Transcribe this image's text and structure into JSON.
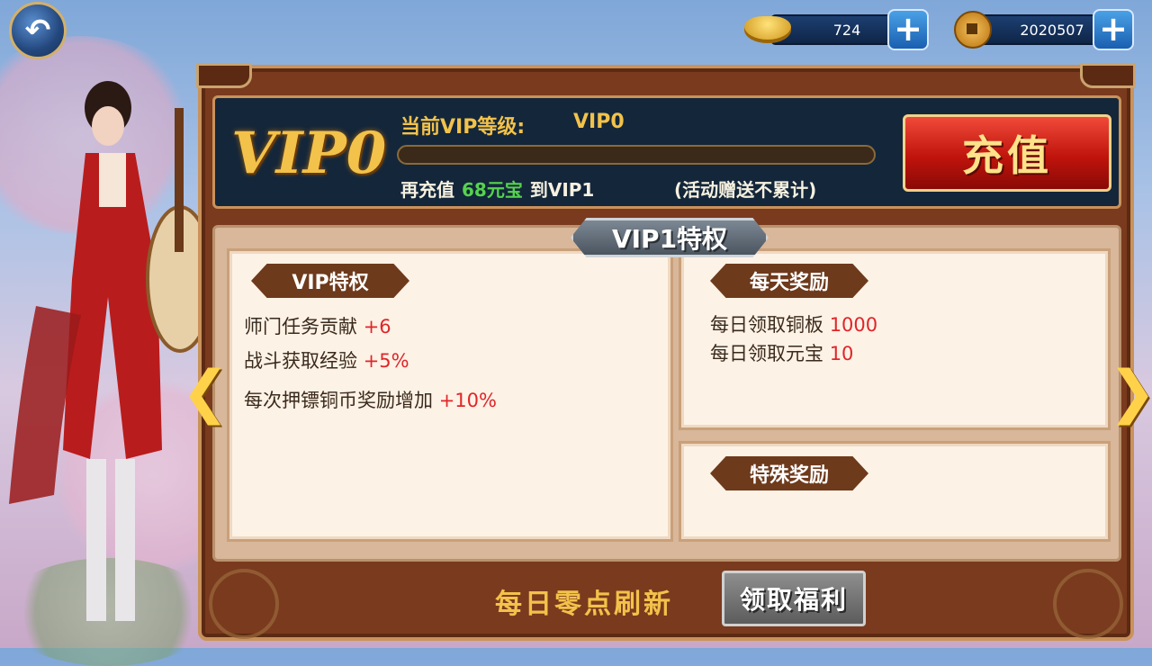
{
  "currency": {
    "gold": "724",
    "coins": "2020507"
  },
  "vip": {
    "badge": "VIP0",
    "current_label": "当前VIP等级:",
    "current_level": "VIP0",
    "progress": 0.0,
    "recharge_prefix": "再充值",
    "recharge_amount": "68元宝",
    "recharge_suffix": "到VIP1",
    "note": "(活动赠送不累计)",
    "recharge_button": "充值"
  },
  "privilege": {
    "title": "VIP1特权",
    "left": {
      "label": "VIP特权",
      "items": [
        {
          "text": "师门任务贡献",
          "value": "+6"
        },
        {
          "text": "战斗获取经验",
          "value": "+5%"
        },
        {
          "text": "每次押镖铜币奖励增加",
          "value": "+10%"
        }
      ]
    },
    "daily": {
      "label": "每天奖励",
      "items": [
        {
          "text": "每日领取铜板",
          "value": "1000"
        },
        {
          "text": "每日领取元宝",
          "value": "10"
        }
      ]
    },
    "special": {
      "label": "特殊奖励"
    }
  },
  "footer": {
    "refresh_text": "每日零点刷新",
    "claim_button": "领取福利"
  },
  "icons": {
    "back": "back-arrow-icon",
    "gold": "gold-ingot-icon",
    "coin": "copper-coin-icon",
    "plus": "plus-icon",
    "prev": "chevron-left-icon",
    "next": "chevron-right-icon"
  },
  "colors": {
    "gold_text": "#f2c24a",
    "value_red": "#e0252a",
    "amount_green": "#55d34e",
    "recharge_red": "#c0140c"
  }
}
